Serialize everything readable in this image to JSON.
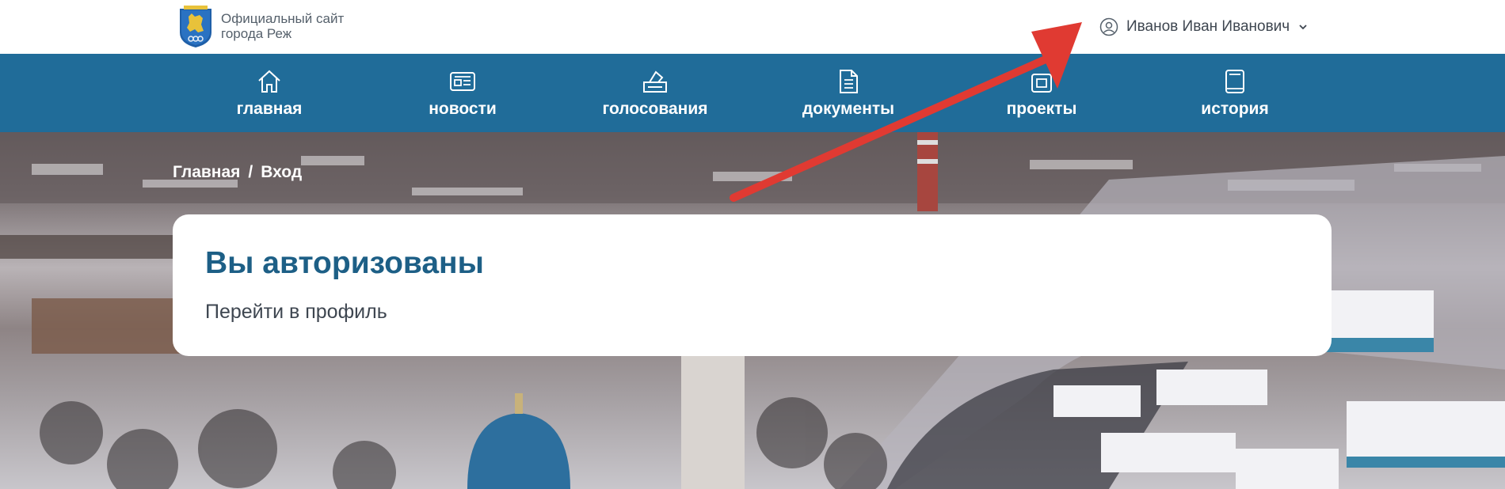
{
  "header": {
    "site_title_line1": "Официальный сайт",
    "site_title_line2": "города Реж",
    "logo_icon": "city-coat-of-arms-icon",
    "user": {
      "name": "Иванов Иван Иванович",
      "icon": "user-circle-icon",
      "dropdown_icon": "chevron-down-icon"
    }
  },
  "nav": {
    "items": [
      {
        "label": "главная",
        "icon": "home-icon"
      },
      {
        "label": "новости",
        "icon": "newspaper-icon"
      },
      {
        "label": "голосования",
        "icon": "ballot-box-icon"
      },
      {
        "label": "документы",
        "icon": "document-icon"
      },
      {
        "label": "проекты",
        "icon": "projects-icon"
      },
      {
        "label": "история",
        "icon": "book-icon"
      }
    ]
  },
  "breadcrumb": {
    "home": "Главная",
    "separator": "/",
    "current": "Вход"
  },
  "card": {
    "title": "Вы авторизованы",
    "profile_link": "Перейти в профиль"
  },
  "colors": {
    "nav_background": "#206c99",
    "title": "#1d5f86",
    "annotation_arrow": "#e03a32"
  }
}
